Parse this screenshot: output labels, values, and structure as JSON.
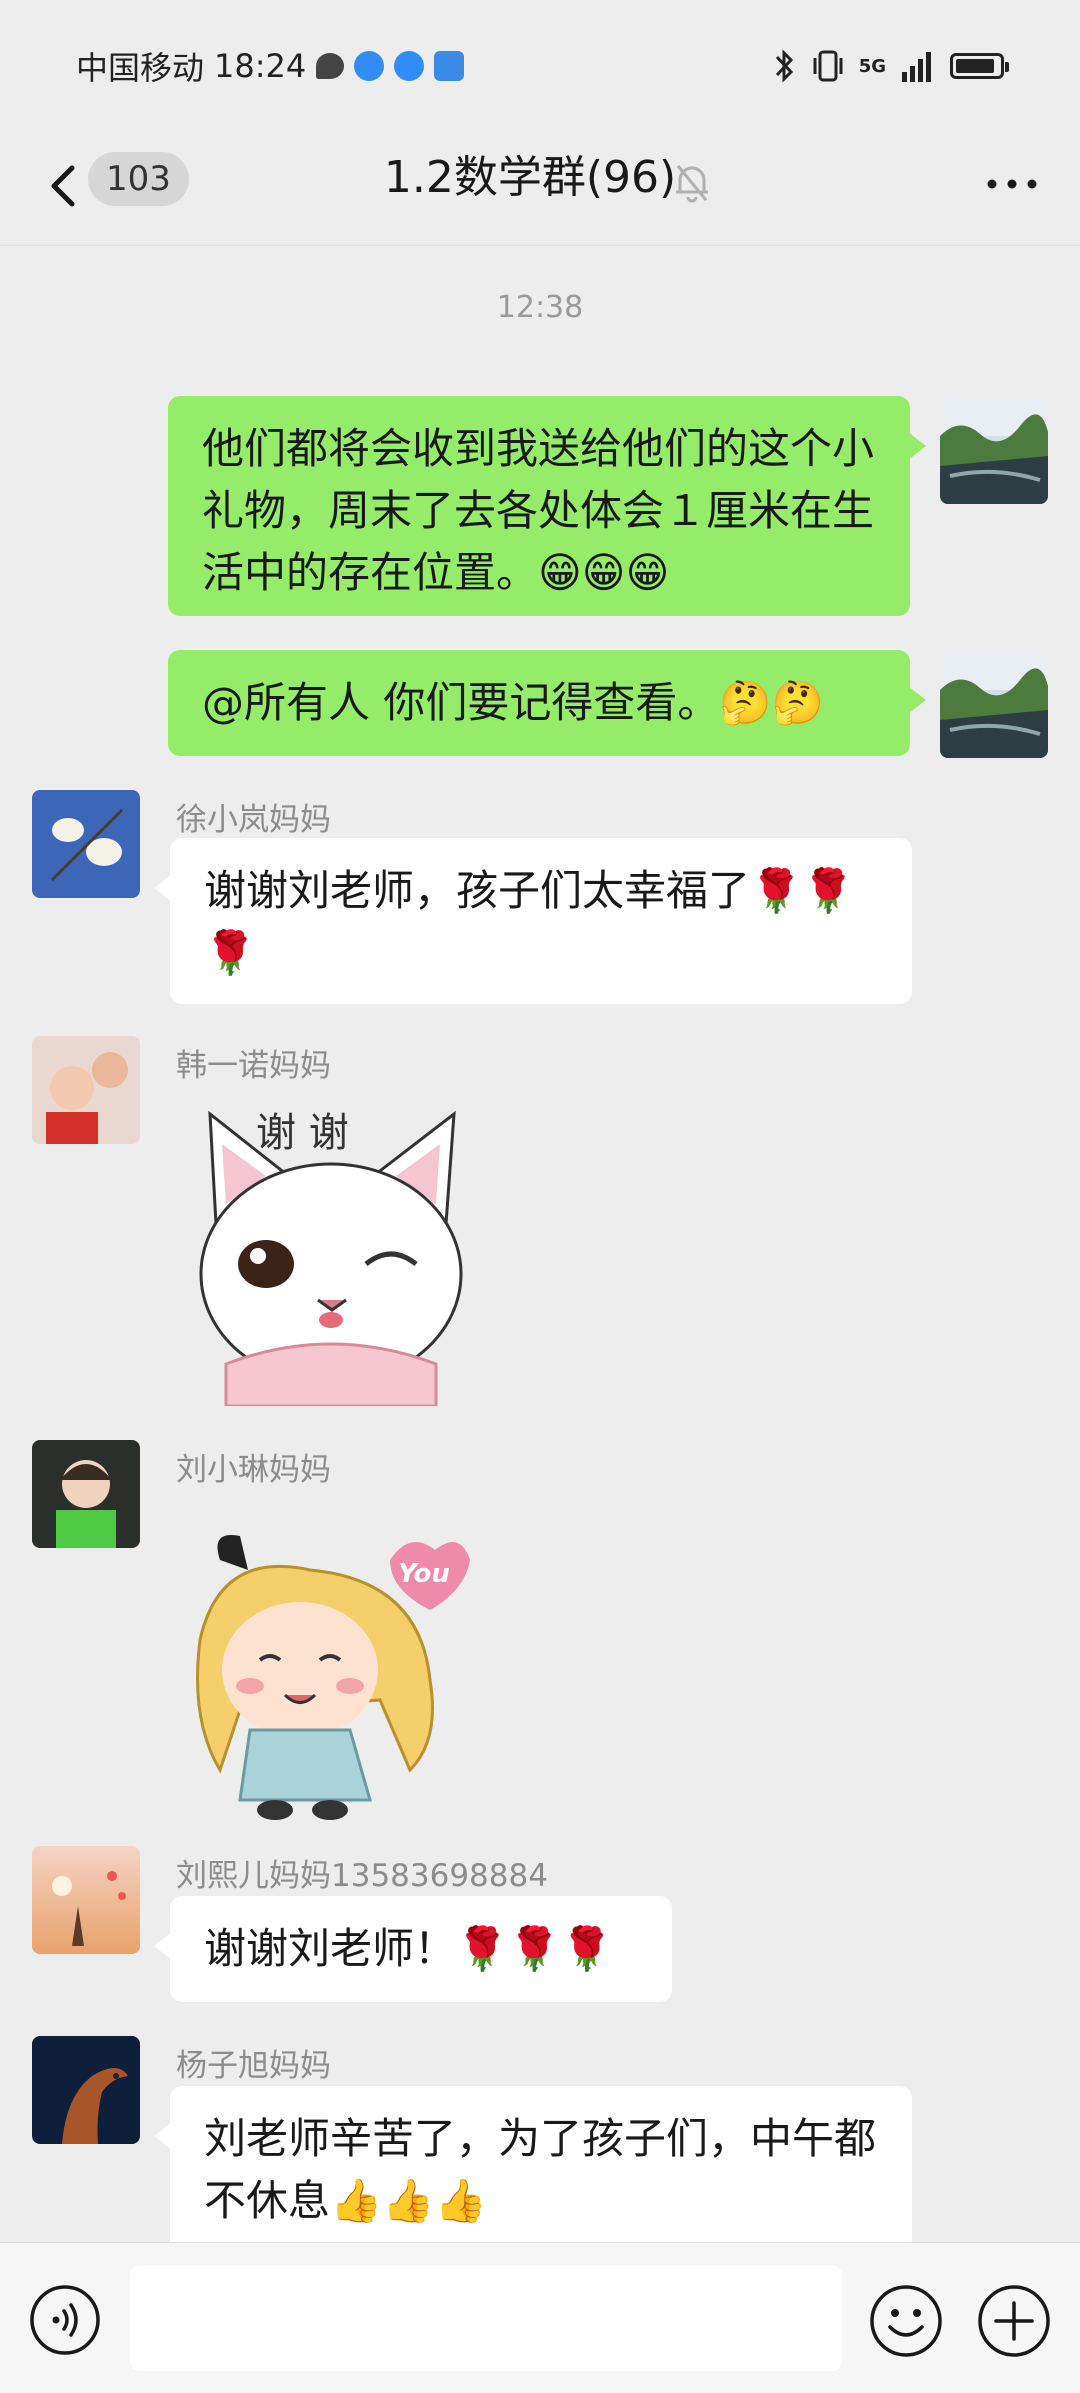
{
  "status_bar": {
    "carrier": "中国移动",
    "time": "18:24",
    "network": "5G"
  },
  "nav": {
    "back_count": "103",
    "title": "1.2数学群(96)",
    "icons": [
      "chevron-left-icon",
      "mute-bell-icon",
      "more-dots-icon"
    ]
  },
  "time_separator": "12:38",
  "messages": [
    {
      "from": "me",
      "text": "他们都将会收到我送给他们的这个小礼物，周末了去各处体会１厘米在生活中的存在位置。😁😁😁"
    },
    {
      "from": "me",
      "text": "@所有人  你们要记得查看。🤔🤔"
    },
    {
      "from": "other",
      "sender": "徐小岚妈妈",
      "text": "谢谢刘老师，孩子们太幸福了🌹🌹🌹"
    },
    {
      "from": "other",
      "sender": "韩一诺妈妈",
      "sticker": "cat-sticker",
      "sticker_text": "谢 谢"
    },
    {
      "from": "other",
      "sender": "刘小琳妈妈",
      "sticker": "girl-sticker",
      "sticker_text": "You"
    },
    {
      "from": "other",
      "sender": "刘熙儿妈妈13583698884",
      "text": "谢谢刘老师！🌹🌹🌹"
    },
    {
      "from": "other",
      "sender": "杨子旭妈妈",
      "text": "刘老师辛苦了，为了孩子们，中午都不休息👍👍👍"
    }
  ],
  "colors": {
    "background": "#ededed",
    "my_bubble": "#95ec69",
    "other_bubble": "#ffffff",
    "meta_text": "#8c8c8c"
  },
  "input_bar": {
    "placeholder": "",
    "icons": [
      "voice-icon",
      "emoji-icon",
      "plus-icon"
    ]
  }
}
